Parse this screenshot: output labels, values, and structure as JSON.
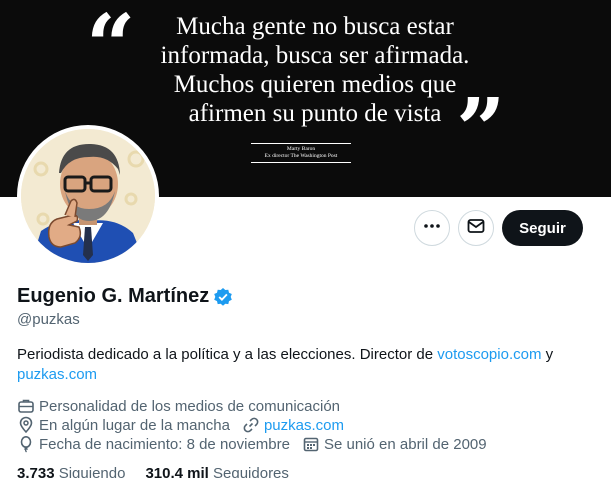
{
  "banner": {
    "quote_lines": [
      "Mucha gente no busca estar",
      "informada, busca ser afirmada.",
      "Muchos quieren medios que",
      "afirmen su punto de vista"
    ],
    "attribution_name": "Marty Baron",
    "attribution_title": "Ex director The Washington Post"
  },
  "actions": {
    "more_icon": "more-horizontal-icon",
    "message_icon": "envelope-icon",
    "follow_label": "Seguir"
  },
  "profile": {
    "name": "Eugenio G. Martínez",
    "handle": "@puzkas",
    "bio_text": "Periodista dedicado a la política y a las elecciones. Director de",
    "bio_link1": "votoscopio.com",
    "bio_connector": " y",
    "bio_link2": "puzkas.com",
    "category": "Personalidad de los medios de comunicación",
    "location": "En algún lugar de la mancha",
    "website": "puzkas.com",
    "birthdate": "Fecha de nacimiento: 8 de noviembre",
    "joined": "Se unió en abril de 2009"
  },
  "stats": {
    "following_count": "3.733",
    "following_label": "Siguiendo",
    "followers_count": "310,4 mil",
    "followers_label": "Seguidores"
  },
  "colors": {
    "accent": "#1d9bf0",
    "text_primary": "#0f1419",
    "text_secondary": "#536471",
    "banner_bg": "#0b0b0b"
  }
}
